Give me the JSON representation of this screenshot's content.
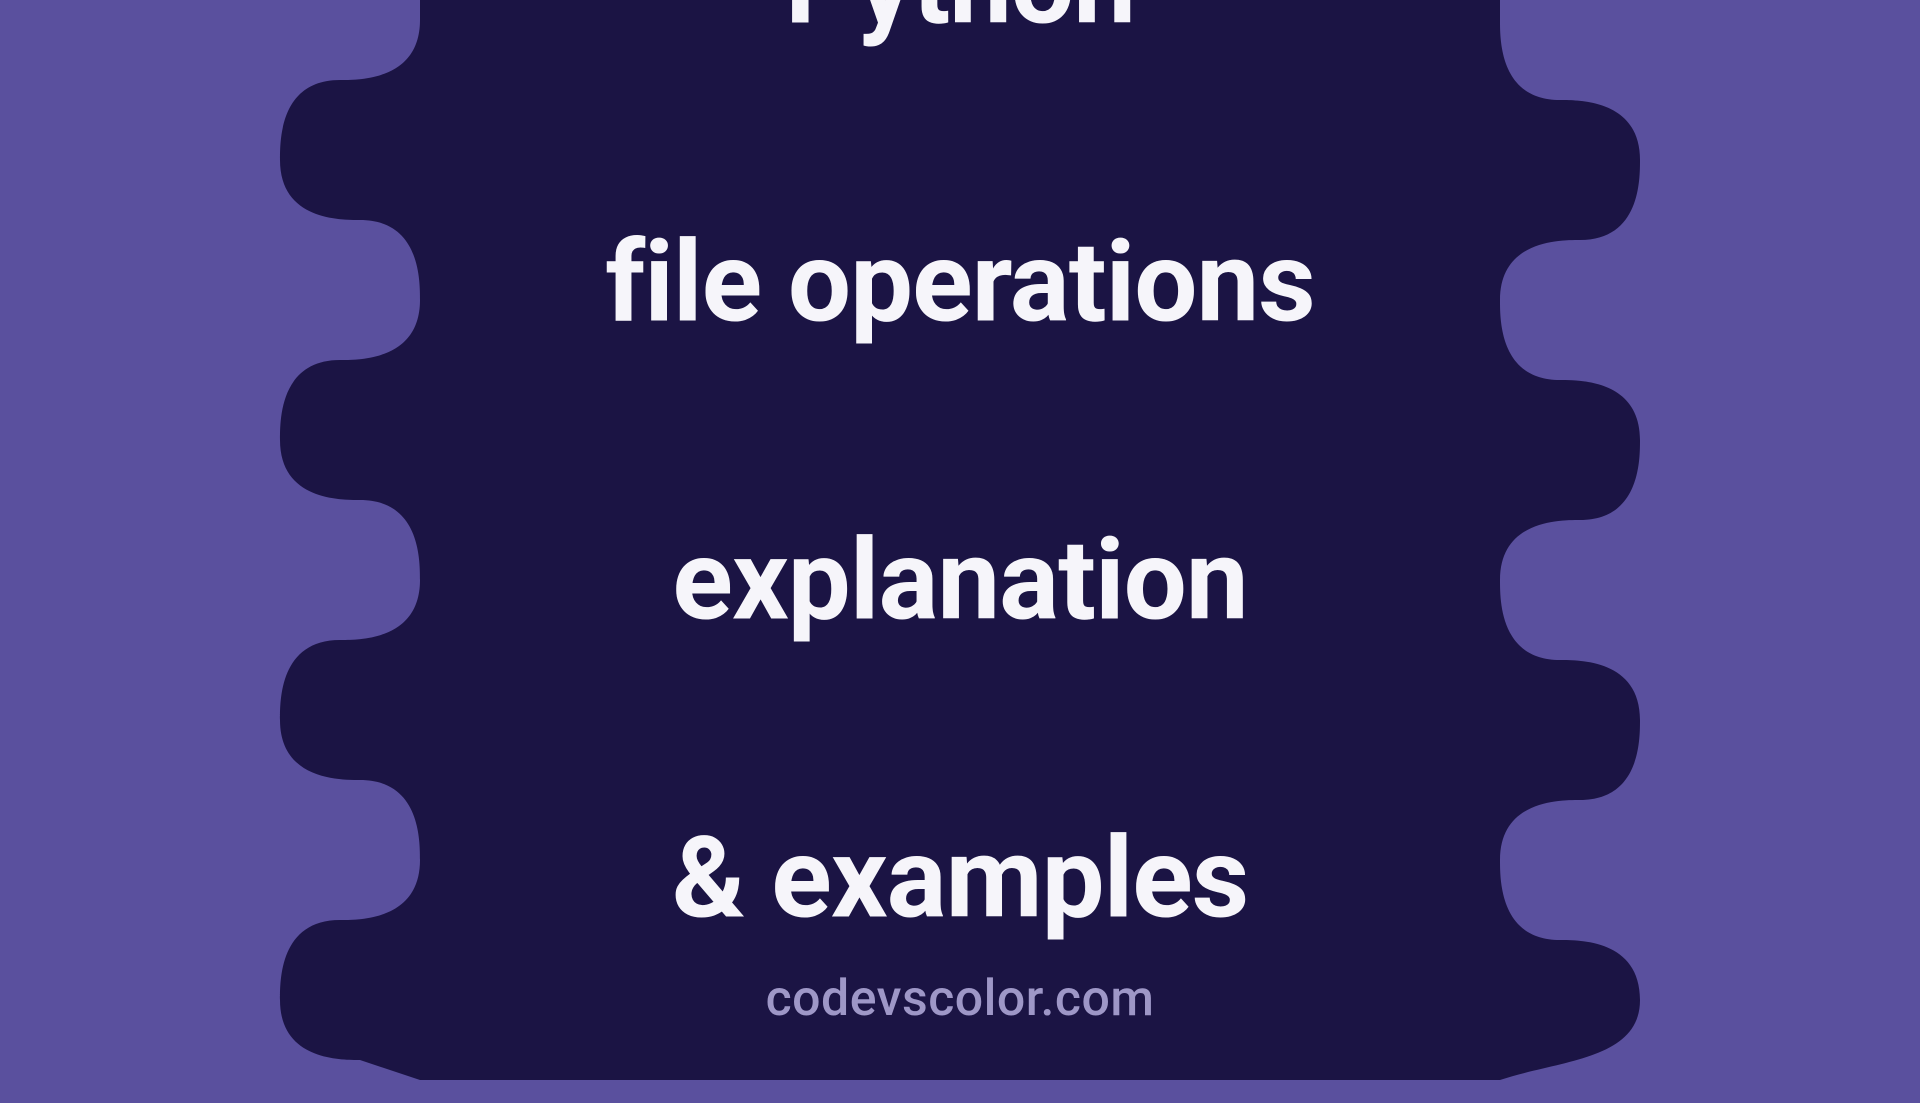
{
  "title": {
    "line1": "Python",
    "line2": "file operations",
    "line3": "explanation",
    "line4": "& examples"
  },
  "site": "codevscolor.com",
  "colors": {
    "background": "#5a509e",
    "blob": "#1b1444",
    "text_primary": "#f6f5fa",
    "text_secondary": "#9e97c7"
  }
}
